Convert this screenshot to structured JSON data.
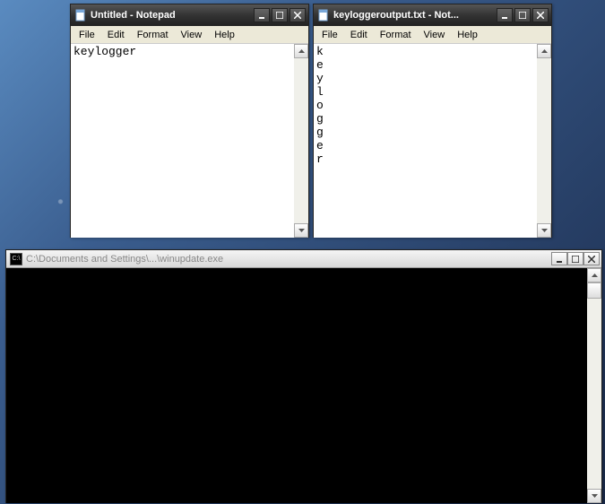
{
  "notepad1": {
    "title": "Untitled - Notepad",
    "menu": {
      "file": "File",
      "edit": "Edit",
      "format": "Format",
      "view": "View",
      "help": "Help"
    },
    "content": "keylogger"
  },
  "notepad2": {
    "title": "keyloggeroutput.txt - Not...",
    "menu": {
      "file": "File",
      "edit": "Edit",
      "format": "Format",
      "view": "View",
      "help": "Help"
    },
    "content": "k\ne\ny\nl\no\ng\ng\ne\nr"
  },
  "console": {
    "title": "C:\\Documents and Settings\\...\\winupdate.exe",
    "icon_text": "C:\\",
    "content": ""
  }
}
